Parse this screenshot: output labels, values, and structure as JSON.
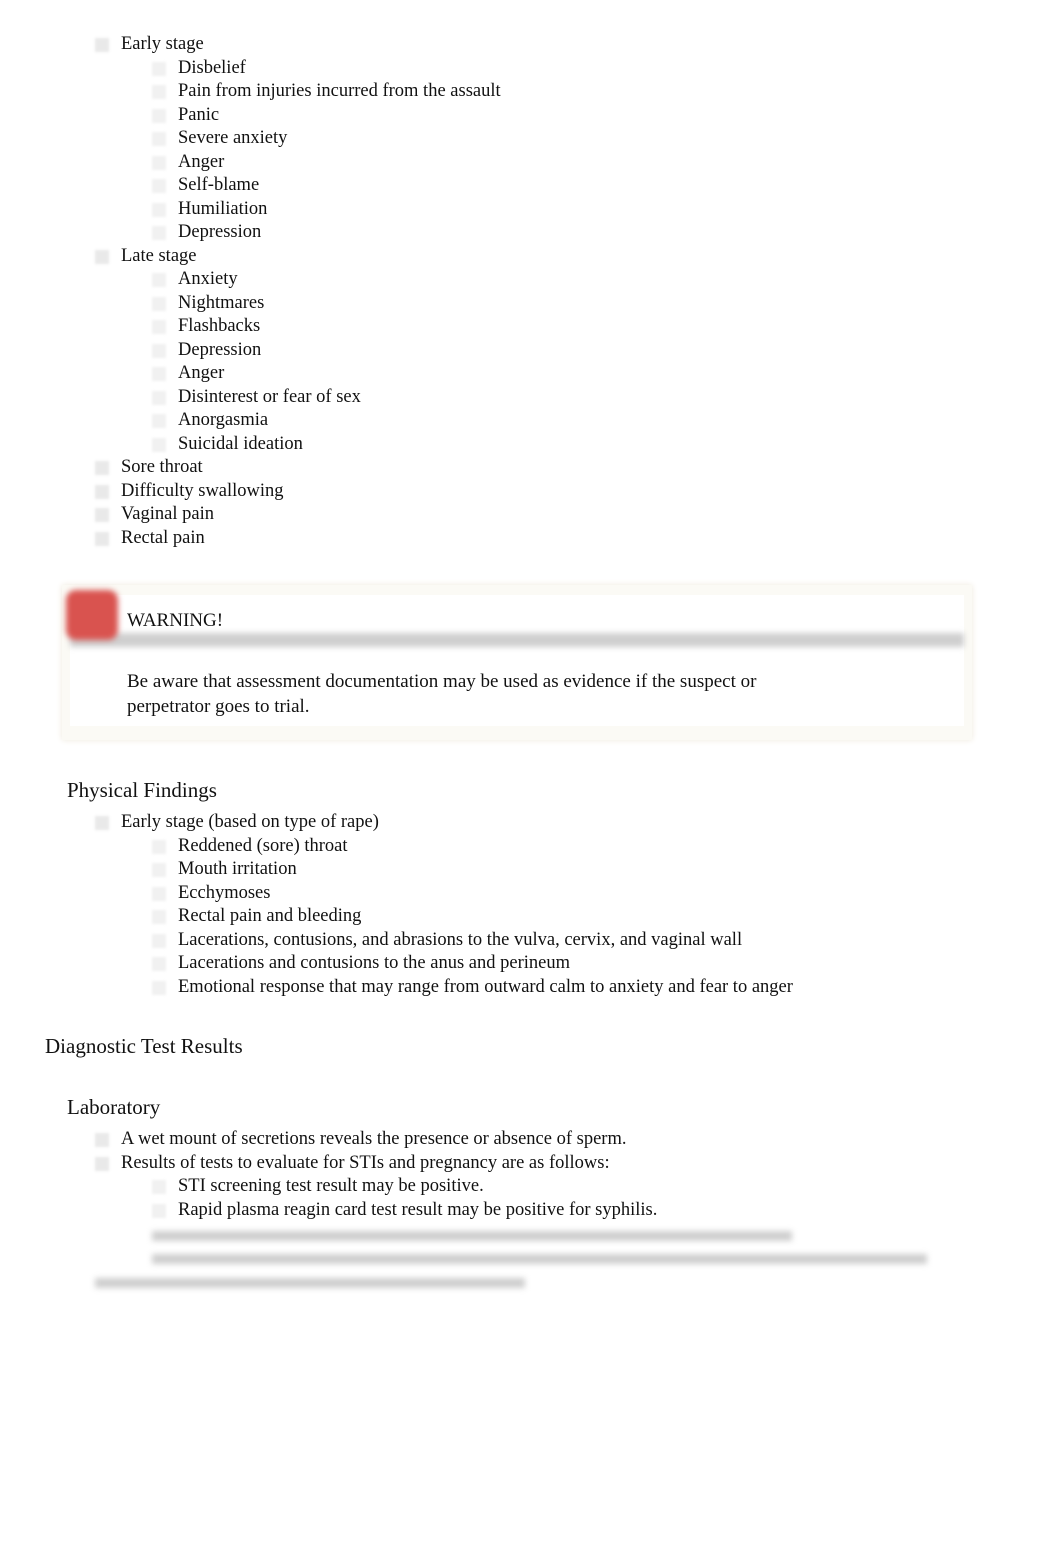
{
  "symptoms": [
    {
      "label": "Early stage",
      "children": [
        "Disbelief",
        "Pain from injuries incurred from the assault",
        "Panic",
        "Severe anxiety",
        "Anger",
        "Self-blame",
        "Humiliation",
        "Depression"
      ]
    },
    {
      "label": "Late stage",
      "children": [
        "Anxiety",
        "Nightmares",
        "Flashbacks",
        "Depression",
        "Anger",
        "Disinterest or fear of sex",
        "Anorgasmia",
        "Suicidal ideation"
      ]
    },
    {
      "label": "Sore throat",
      "children": []
    },
    {
      "label": "Difficulty swallowing",
      "children": []
    },
    {
      "label": "Vaginal pain",
      "children": []
    },
    {
      "label": "Rectal pain",
      "children": []
    }
  ],
  "warning": {
    "title": "WARNING!",
    "body": "Be aware that assessment documentation may be used as evidence if the suspect or perpetrator goes to trial.",
    "icon": "warning-icon",
    "accent": "#d9534f"
  },
  "physical_findings": {
    "heading": "Physical Findings",
    "items": [
      {
        "label": "Early stage (based on type of rape)",
        "children": [
          "Reddened (sore) throat",
          "Mouth irritation",
          "Ecchymoses",
          "Rectal pain and bleeding",
          "Lacerations, contusions, and abrasions to the vulva, cervix, and vaginal wall",
          "Lacerations and contusions to the anus and perineum",
          "Emotional response that may range from outward calm to anxiety and fear to anger"
        ]
      }
    ]
  },
  "diagnostic": {
    "heading": "Diagnostic Test Results",
    "subheading": "Laboratory",
    "items": [
      {
        "label": "A wet mount of secretions reveals the presence or absence of sperm.",
        "children": []
      },
      {
        "label": "Results of tests to evaluate for STIs and pregnancy are as follows:",
        "children": [
          "STI screening test result may be positive.",
          "Rapid plasma reagin card test result may be positive for syphilis."
        ]
      }
    ]
  }
}
